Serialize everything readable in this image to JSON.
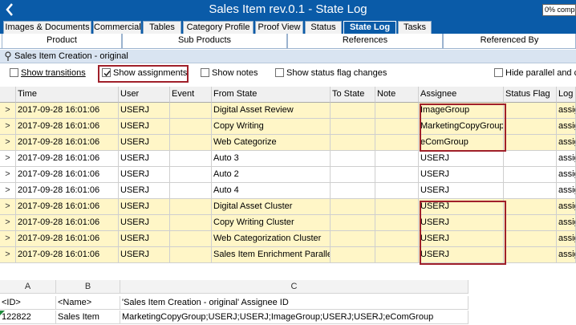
{
  "window": {
    "title": "Sales Item rev.0.1 - State Log",
    "completion_value": "0% comp"
  },
  "tabs_primary": [
    {
      "label": "Images & Documents"
    },
    {
      "label": "Commercial"
    },
    {
      "label": "Tables"
    },
    {
      "label": "Category Profile"
    },
    {
      "label": "Proof View"
    },
    {
      "label": "Status"
    },
    {
      "label": "State Log",
      "active": true
    },
    {
      "label": "Tasks"
    }
  ],
  "tabs_secondary": [
    {
      "label": "Product"
    },
    {
      "label": "Sub Products"
    },
    {
      "label": "References"
    },
    {
      "label": "Referenced By"
    }
  ],
  "group": {
    "title": "Sales Item Creation - original"
  },
  "options": {
    "show_transitions": {
      "label": "Show transitions",
      "checked": false
    },
    "show_assignments": {
      "label": "Show assignments",
      "checked": true
    },
    "show_notes": {
      "label": "Show notes",
      "checked": false
    },
    "show_status_flag_changes": {
      "label": "Show status flag changes",
      "checked": false
    },
    "hide_parallel": {
      "label": "Hide parallel and cl",
      "checked": false
    }
  },
  "grid": {
    "columns": [
      "Time",
      "User",
      "Event",
      "From State",
      "To State",
      "Note",
      "Assignee",
      "Status Flag",
      "Log T"
    ],
    "rows": [
      {
        "expander": ">",
        "time": "2017-09-28 16:01:06",
        "user": "USERJ",
        "event": "",
        "from_state": "Digital Asset Review",
        "to_state": "",
        "note": "",
        "assignee": "ImageGroup",
        "status_flag": "",
        "log_type": "assig",
        "highlight": true
      },
      {
        "expander": ">",
        "time": "2017-09-28 16:01:06",
        "user": "USERJ",
        "event": "",
        "from_state": "Copy Writing",
        "to_state": "",
        "note": "",
        "assignee": "MarketingCopyGroup",
        "status_flag": "",
        "log_type": "assig",
        "highlight": true
      },
      {
        "expander": ">",
        "time": "2017-09-28 16:01:06",
        "user": "USERJ",
        "event": "",
        "from_state": "Web Categorize",
        "to_state": "",
        "note": "",
        "assignee": "eComGroup",
        "status_flag": "",
        "log_type": "assig",
        "highlight": true
      },
      {
        "expander": ">",
        "time": "2017-09-28 16:01:06",
        "user": "USERJ",
        "event": "",
        "from_state": "Auto 3",
        "to_state": "",
        "note": "",
        "assignee": "USERJ",
        "status_flag": "",
        "log_type": "assig",
        "highlight": false
      },
      {
        "expander": ">",
        "time": "2017-09-28 16:01:06",
        "user": "USERJ",
        "event": "",
        "from_state": "Auto 2",
        "to_state": "",
        "note": "",
        "assignee": "USERJ",
        "status_flag": "",
        "log_type": "assig",
        "highlight": false
      },
      {
        "expander": ">",
        "time": "2017-09-28 16:01:06",
        "user": "USERJ",
        "event": "",
        "from_state": "Auto 4",
        "to_state": "",
        "note": "",
        "assignee": "USERJ",
        "status_flag": "",
        "log_type": "assig",
        "highlight": false
      },
      {
        "expander": ">",
        "time": "2017-09-28 16:01:06",
        "user": "USERJ",
        "event": "",
        "from_state": "Digital Asset Cluster",
        "to_state": "",
        "note": "",
        "assignee": "USERJ",
        "status_flag": "",
        "log_type": "assig",
        "highlight": true
      },
      {
        "expander": ">",
        "time": "2017-09-28 16:01:06",
        "user": "USERJ",
        "event": "",
        "from_state": "Copy Writing Cluster",
        "to_state": "",
        "note": "",
        "assignee": "USERJ",
        "status_flag": "",
        "log_type": "assig",
        "highlight": true
      },
      {
        "expander": ">",
        "time": "2017-09-28 16:01:06",
        "user": "USERJ",
        "event": "",
        "from_state": "Web Categorization Cluster",
        "to_state": "",
        "note": "",
        "assignee": "USERJ",
        "status_flag": "",
        "log_type": "assig",
        "highlight": true
      },
      {
        "expander": ">",
        "time": "2017-09-28 16:01:06",
        "user": "USERJ",
        "event": "",
        "from_state": "Sales Item Enrichment Parallel",
        "to_state": "",
        "note": "",
        "assignee": "USERJ",
        "status_flag": "",
        "log_type": "assig",
        "highlight": true
      }
    ]
  },
  "spreadsheet": {
    "col_headers": [
      "A",
      "B",
      "C"
    ],
    "rows": [
      [
        "<ID>",
        "<Name>",
        "'Sales Item Creation - original' Assignee ID"
      ],
      [
        "122822",
        "Sales Item",
        "MarketingCopyGroup;USERJ;USERJ;ImageGroup;USERJ;USERJ;eComGroup"
      ]
    ]
  },
  "colors": {
    "titlebar": "#0a5ba8",
    "highlight_row": "#fff6c7",
    "annotation_red": "#a0202a",
    "group_header": "#d9e4f1"
  }
}
